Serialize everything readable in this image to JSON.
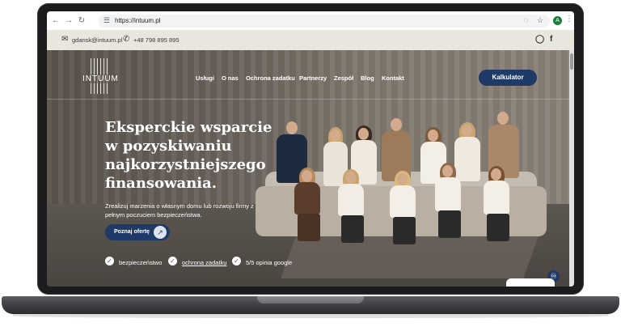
{
  "browser": {
    "url": "https://intuum.pl",
    "profile_initial": "A"
  },
  "contact": {
    "email": "gdansk@intuum.pl",
    "phone": "+48 798 895 895"
  },
  "logo": {
    "text": "INTUUM"
  },
  "nav": {
    "items": [
      "Usługi",
      "O nas",
      "Ochrona zadatku",
      "Partnerzy",
      "Zespół",
      "Blog",
      "Kontakt"
    ],
    "cta_label": "Kalkulator"
  },
  "hero": {
    "headline": "Eksperckie wsparcie w pozyskiwaniu najkorzystniejszego finansowania.",
    "subtext": "Zrealizuj marzenia o własnym domu lub rozwoju firmy z pełnym poczuciem bezpieczeństwa.",
    "cta_label": "Poznaj ofertę",
    "features": [
      "bezpieczeństwo",
      "ochrona zadatku",
      "5/5 opinia google"
    ]
  },
  "colors": {
    "accent": "#1f3a66",
    "infobar": "#e9e6dd",
    "laptop": "#1c1c1e"
  },
  "icons": {
    "back": "arrow-left-icon",
    "forward": "arrow-right-icon",
    "reload": "reload-icon",
    "site_info": "tune-icon",
    "eye_off": "eye-off-icon",
    "bookmark": "star-icon",
    "email": "mail-icon",
    "phone": "phone-icon",
    "instagram": "instagram-icon",
    "facebook": "facebook-icon",
    "accessibility": "accessibility-icon"
  }
}
